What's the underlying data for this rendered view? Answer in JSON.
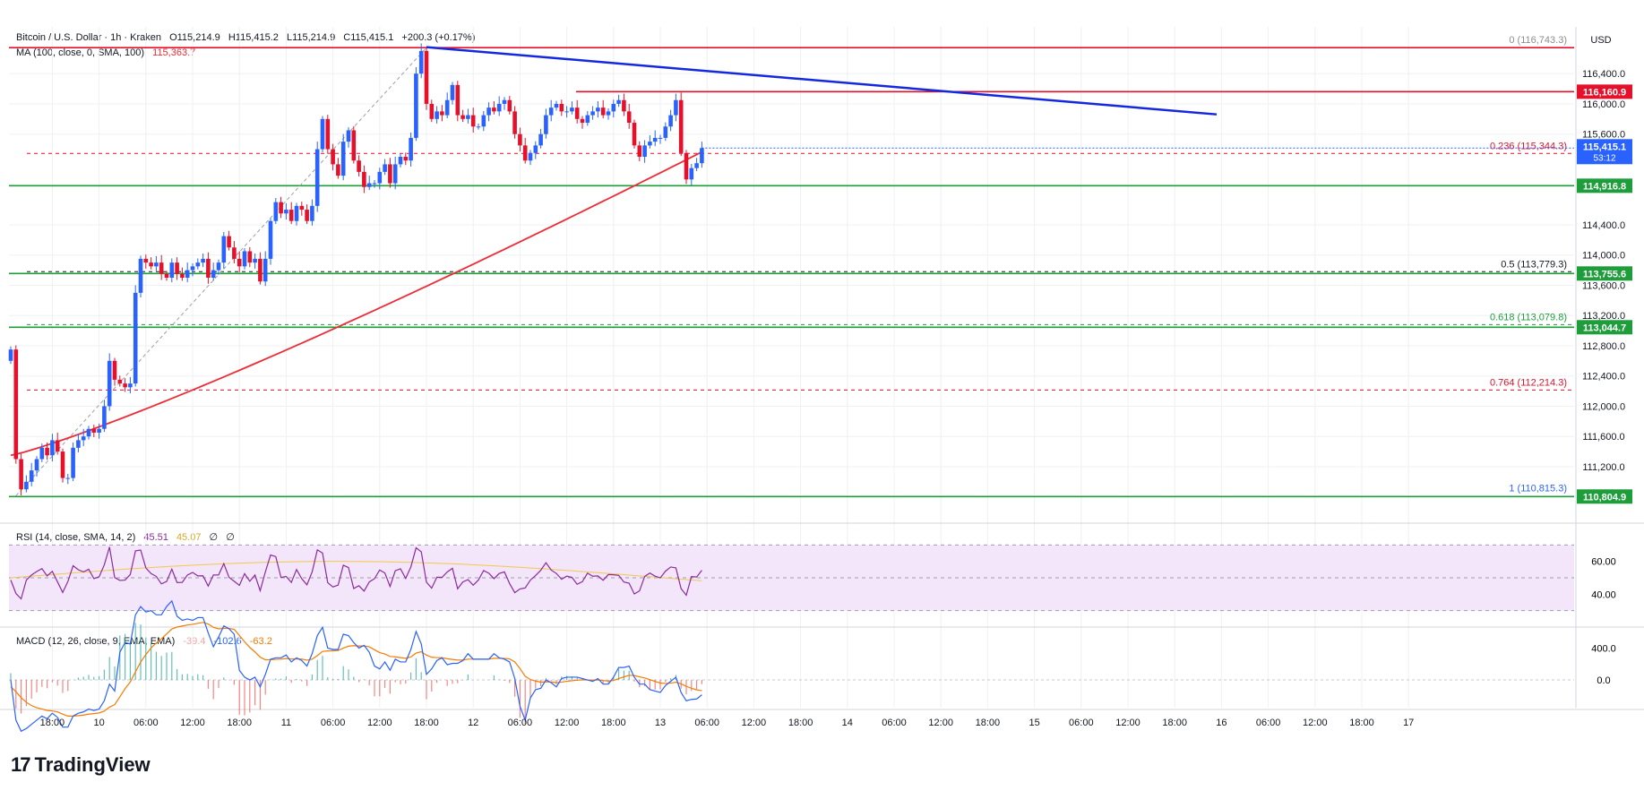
{
  "title_line": {
    "symbol": "Bitcoin / U.S. Dollar · 1h · Kraken",
    "open": "O115,214.9",
    "high": "H115,415.2",
    "low": "L115,214.9",
    "close": "C115,415.1",
    "change": "+200.3 (+0.17%)"
  },
  "ma_legend": {
    "label": "MA (100, close, 0, SMA, 100)",
    "value": "115,363.7"
  },
  "rsi_legend": {
    "label": "RSI (14, close, SMA, 14, 2)",
    "v1": "45.51",
    "v2": "45.07",
    "v3": "∅",
    "v4": "∅"
  },
  "macd_legend": {
    "label": "MACD (12, 26, close, 9, EMA, EMA)",
    "v1": "-39.4",
    "v2": "-102.6",
    "v3": "-63.2"
  },
  "currency": "USD",
  "branding": {
    "logo_text": "TradingView",
    "logo_mark": "17"
  },
  "colors": {
    "up": "#2962ff",
    "down": "#e5112b",
    "ma": "#ef2b36",
    "trend": "#1428e0",
    "support": "#1e9e3a",
    "resistance": "#e5112b",
    "rsi": "#8a2c9c",
    "rsi_ma": "#f2c94c",
    "rsi_band": "#f3e5fa",
    "macd": "#2962ff",
    "signal": "#f57c00",
    "fib": "#8d8d8d",
    "grid": "#eef0f3"
  },
  "chart_data": {
    "type": "candlestick",
    "price_axis": {
      "min": 110500,
      "max": 116900,
      "ticks": [
        116400,
        116000,
        115600,
        114400,
        114000,
        113600,
        113200,
        112800,
        112400,
        112000,
        111600,
        111200
      ]
    },
    "time_axis": {
      "start": 0,
      "end": 201,
      "labels": [
        {
          "t": 8,
          "label": "18:00"
        },
        {
          "t": 17,
          "label": "10"
        },
        {
          "t": 26,
          "label": "06:00"
        },
        {
          "t": 35,
          "label": "12:00"
        },
        {
          "t": 44,
          "label": "18:00"
        },
        {
          "t": 53,
          "label": "11"
        },
        {
          "t": 62,
          "label": "06:00"
        },
        {
          "t": 71,
          "label": "12:00"
        },
        {
          "t": 80,
          "label": "18:00"
        },
        {
          "t": 89,
          "label": "12"
        },
        {
          "t": 98,
          "label": "06:00"
        },
        {
          "t": 107,
          "label": "12:00"
        },
        {
          "t": 116,
          "label": "18:00"
        },
        {
          "t": 125,
          "label": "13"
        },
        {
          "t": 134,
          "label": "06:00"
        },
        {
          "t": 143,
          "label": "12:00"
        },
        {
          "t": 152,
          "label": "18:00"
        },
        {
          "t": 161,
          "label": "14"
        },
        {
          "t": 170,
          "label": "06:00"
        },
        {
          "t": 179,
          "label": "12:00"
        },
        {
          "t": 188,
          "label": "18:00"
        },
        {
          "t": 197,
          "label": "15"
        },
        {
          "t": 206,
          "label": "06:00"
        },
        {
          "t": 215,
          "label": "12:00"
        },
        {
          "t": 224,
          "label": "18:00"
        },
        {
          "t": 233,
          "label": "16"
        },
        {
          "t": 242,
          "label": "06:00"
        },
        {
          "t": 251,
          "label": "12:00"
        },
        {
          "t": 260,
          "label": "18:00"
        },
        {
          "t": 269,
          "label": "17"
        }
      ]
    },
    "close_series": [
      112750,
      111300,
      110900,
      111000,
      111150,
      111300,
      111450,
      111350,
      111550,
      111400,
      111050,
      111050,
      111450,
      111550,
      111600,
      111700,
      111650,
      111700,
      112000,
      112600,
      112350,
      112300,
      112250,
      112300,
      113500,
      113950,
      113900,
      113850,
      113900,
      113750,
      113700,
      113900,
      113750,
      113700,
      113800,
      113850,
      113900,
      113950,
      113700,
      113800,
      113900,
      114250,
      114100,
      113950,
      113850,
      114050,
      113900,
      113950,
      113650,
      113950,
      114450,
      114700,
      114550,
      114600,
      114450,
      114650,
      114600,
      114450,
      114650,
      115400,
      115800,
      115400,
      115200,
      115050,
      115500,
      115650,
      115250,
      115100,
      114900,
      114950,
      114950,
      115100,
      115200,
      114950,
      115200,
      115300,
      115250,
      115550,
      116400,
      116700,
      116000,
      115800,
      115900,
      115850,
      116050,
      116250,
      115850,
      115800,
      115850,
      115700,
      115700,
      115850,
      115950,
      115900,
      116000,
      116050,
      115900,
      115600,
      115450,
      115250,
      115350,
      115450,
      115600,
      115850,
      115950,
      116000,
      115900,
      115900,
      115950,
      115800,
      115750,
      115850,
      115900,
      115950,
      115850,
      115900,
      116000,
      116050,
      115900,
      115750,
      115450,
      115300,
      115450,
      115500,
      115550,
      115550,
      115700,
      115850,
      116050,
      115350,
      115000,
      115150,
      115215,
      115415
    ],
    "ma_series_start": 111350,
    "ma_series_end": 115364,
    "last_price": "115,415.1",
    "last_countdown": "53:12",
    "price_labels": [
      {
        "value": 116160.9,
        "label": "116,160.9",
        "color": "#e5112b"
      },
      {
        "value": 114916.8,
        "label": "114,916.8",
        "color": "#1e9e3a"
      },
      {
        "value": 113755.6,
        "label": "113,755.6",
        "color": "#1e9e3a"
      },
      {
        "value": 113044.7,
        "label": "113,044.7",
        "color": "#1e9e3a"
      },
      {
        "value": 110804.9,
        "label": "110,804.9",
        "color": "#1e9e3a"
      },
      {
        "value": 116743.3,
        "label": "",
        "color": "#e5112b"
      }
    ],
    "fib_levels": [
      {
        "ratio": "0",
        "value": 116743.3,
        "label": "0 (116,743.3)",
        "color": "#8d8d8d"
      },
      {
        "ratio": "0.236",
        "value": 115344.3,
        "label": "0.236 (115,344.3)",
        "color": "#e5112b"
      },
      {
        "ratio": "0.5",
        "value": 113779.3,
        "label": "0.5 (113,779.3)",
        "color": "#131722"
      },
      {
        "ratio": "0.618",
        "value": 113079.8,
        "label": "0.618 (113,079.8)",
        "color": "#1e9e3a"
      },
      {
        "ratio": "0.764",
        "value": 112214.3,
        "label": "0.764 (112,214.3)",
        "color": "#e5112b"
      },
      {
        "ratio": "1",
        "value": 110815.3,
        "label": "1 (110,815.3)",
        "color": "#2962ff"
      }
    ],
    "trendline": {
      "from": {
        "t": 80,
        "price": 116750
      },
      "to": {
        "t": 145,
        "price": 115920
      }
    },
    "rsi": {
      "ticks": [
        60,
        40
      ],
      "band": [
        70,
        30
      ],
      "last": 45.51
    },
    "macd": {
      "ticks": [
        "400.0",
        "0.0"
      ],
      "range": [
        -350,
        600
      ]
    }
  }
}
